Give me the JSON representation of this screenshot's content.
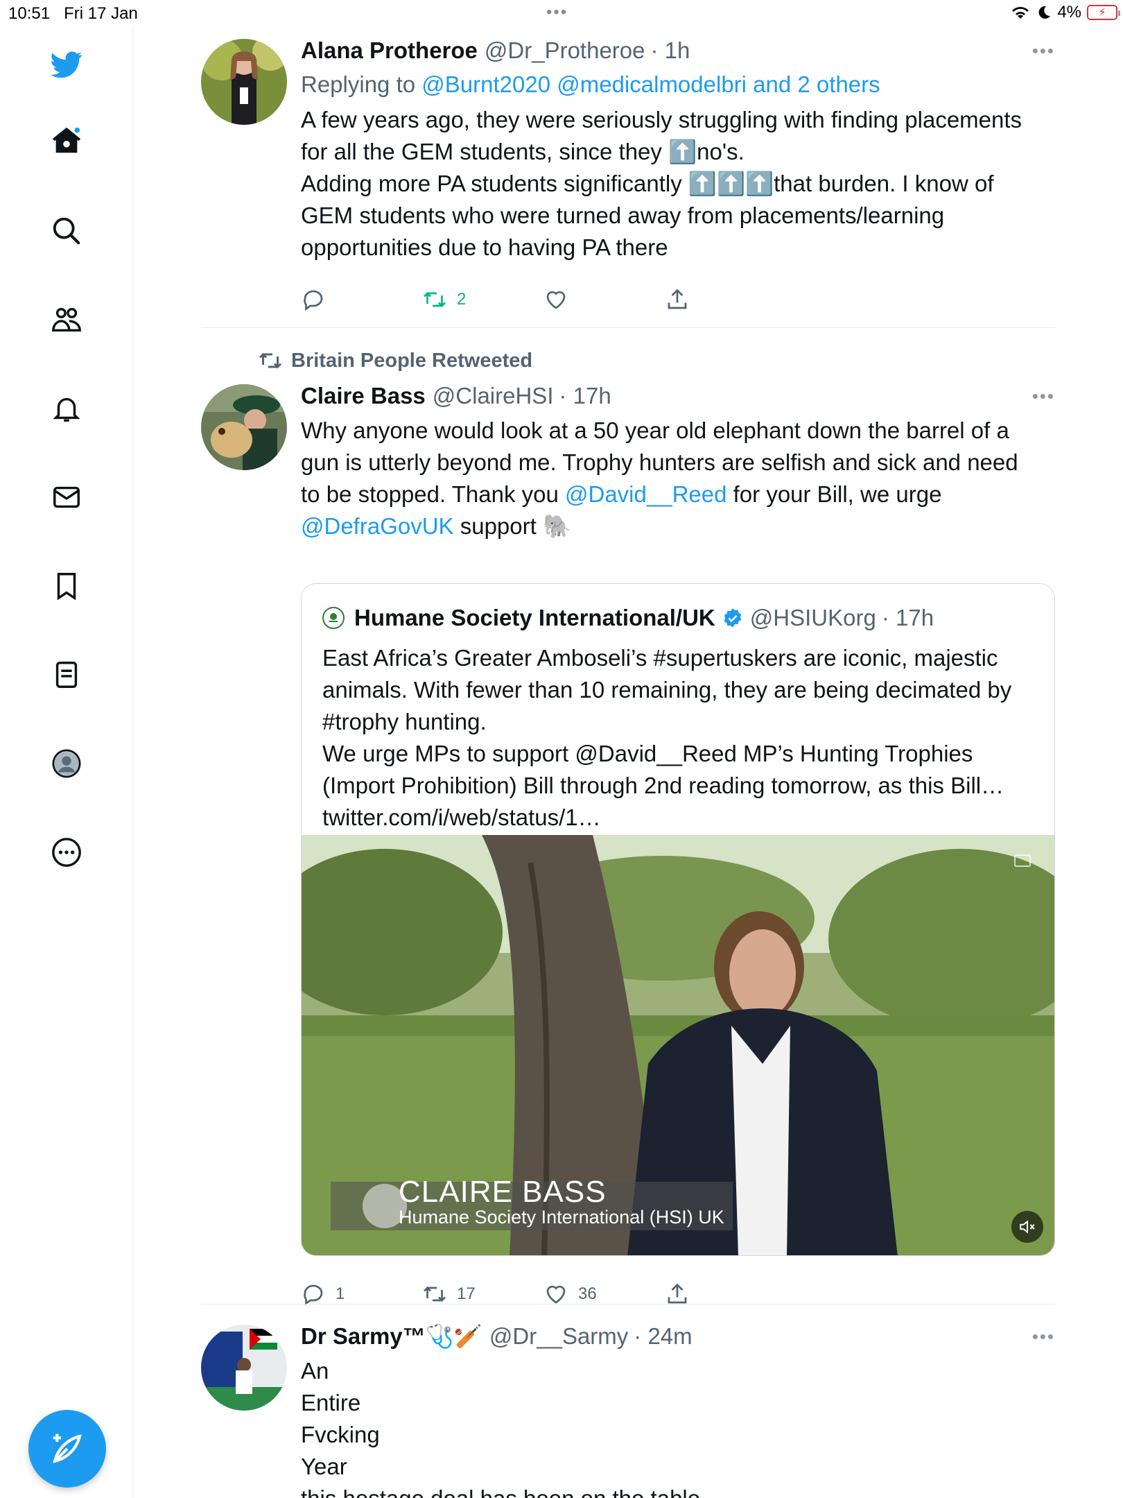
{
  "status_bar": {
    "time": "10:51",
    "date": "Fri 17 Jan",
    "battery": "4%"
  },
  "sidebar": {
    "items": [
      {
        "icon": "twitter-logo-icon"
      },
      {
        "icon": "home-icon"
      },
      {
        "icon": "search-icon"
      },
      {
        "icon": "communities-icon"
      },
      {
        "icon": "notifications-icon"
      },
      {
        "icon": "messages-icon"
      },
      {
        "icon": "bookmarks-icon"
      },
      {
        "icon": "lists-icon"
      },
      {
        "icon": "profile-icon"
      },
      {
        "icon": "more-icon"
      }
    ],
    "compose_icon": "compose-tweet-icon",
    "accent": "#1d9bf0"
  },
  "tweets": [
    {
      "name": "Alana Protheroe",
      "handle": "@Dr_Protheroe",
      "time": "· 1h",
      "replying_prefix": "Replying to",
      "replying_to": "@Burnt2020 @medicalmodelbri and 2 others",
      "body": "A few years ago, they were seriously struggling with finding placements\nfor all the GEM students, since they ⬆️no's.\nAdding more PA students significantly ⬆️⬆️⬆️that burden. I know of\nGEM students who were turned away from placements/learning\nopportunities due to having PA there",
      "replies": "",
      "retweets": "2",
      "likes": ""
    },
    {
      "retweeted_by": "Britain People Retweeted",
      "name": "Claire Bass",
      "handle": "@ClaireHSI",
      "time": "· 17h",
      "body_part1": "Why anyone would look at a 50 year old elephant down the barrel of a\ngun is utterly beyond me. Trophy hunters are selfish and sick and need\nto be stopped. Thank you ",
      "mention1": "@David__Reed",
      "body_part2": " for your Bill, we urge\n",
      "mention2": "@DefraGovUK",
      "body_part3": " support 🐘",
      "quote": {
        "name": "Humane Society International/UK",
        "handle": "@HSIUKorg",
        "time": "· 17h",
        "body": "East Africa’s Greater Amboseli’s #supertuskers are iconic, majestic\nanimals. With fewer than 10 remaining, they are being decimated by\n#trophy hunting.\nWe urge MPs to support @David__Reed MP’s Hunting Trophies\n(Import Prohibition) Bill through 2nd reading tomorrow, as this Bill…\ntwitter.com/i/web/status/1…",
        "video_caption_name": "CLAIRE BASS",
        "video_caption_org": "Humane Society International (HSI) UK"
      },
      "replies": "1",
      "retweets": "17",
      "likes": "36"
    },
    {
      "name": "Dr Sarmy™🩺🏏",
      "handle": "@Dr__Sarmy",
      "time": "· 24m",
      "body": "An\nEntire\nFvcking\nYear\nthis hostage deal has been on the table"
    }
  ]
}
